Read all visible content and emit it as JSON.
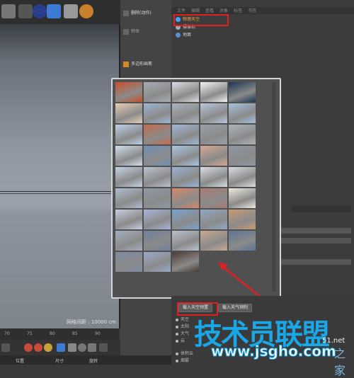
{
  "viewport": {
    "status_text": "网格间距 : 10000 cm"
  },
  "midpanel": {
    "items": [
      "删除(动作)",
      "物体",
      "多边形画笔",
      "载入天空预置",
      "载入天气预制"
    ]
  },
  "object_manager": {
    "menu": [
      "文件",
      "编辑",
      "查看",
      "对象",
      "标签",
      "书签"
    ],
    "objects": [
      {
        "label": "物理天空",
        "icon_color": "#4aa0ff"
      },
      {
        "label": "摄像机",
        "icon_color": "#9aa9b8"
      },
      {
        "label": "地面",
        "icon_color": "#5a8fd0"
      }
    ]
  },
  "popup": {
    "thumbnails": [
      "#c9502b",
      "#a9adb3",
      "#d9dde2",
      "#f2f3f5",
      "#1c3552",
      "#e7cdb6",
      "#9cb7d6",
      "#aab4bf",
      "#b8c7de",
      "#a6c1dc",
      "#bcd0e8",
      "#c46a4d",
      "#9fb7d5",
      "#9aa0a8",
      "#aeb4bb",
      "#cfe0ef",
      "#6f8fb6",
      "#a9c7e3",
      "#d6a88f",
      "#8d98a5",
      "#c2d3e6",
      "#b9c3cf",
      "#98b4d3",
      "#d9dde2",
      "#d8dde3",
      "#aebdd0",
      "#8e9aa8",
      "#d8876a",
      "#aa7b72",
      "#ede9dc",
      "#c4cde0",
      "#a6b5d9",
      "#7aa3d1",
      "#93a8c5",
      "#c89a74",
      "#a3afc2",
      "#6f7f9c",
      "#b9c2d2",
      "#c7a88e",
      "#5d7395",
      "#7d8aa3",
      "#9aa9c9",
      "#4a3a33"
    ]
  },
  "attributes": {
    "load_preset_button": "载入天空预置",
    "load_weather_button": "载入天气预制",
    "props": [
      "天空",
      "太阳",
      "大气",
      "云"
    ],
    "props2": [
      "体积云",
      "烟雾"
    ]
  },
  "timeline": {
    "ticks": [
      "70",
      "75",
      "80",
      "85",
      "90"
    ]
  },
  "coords": {
    "pos_label": "位置",
    "size_label": "尺寸",
    "rot_label": "旋转"
  },
  "watermark": {
    "main": "技术员联盟",
    "url": "www.jsgho.com",
    "tail": "51.net",
    "cn": "之家"
  }
}
